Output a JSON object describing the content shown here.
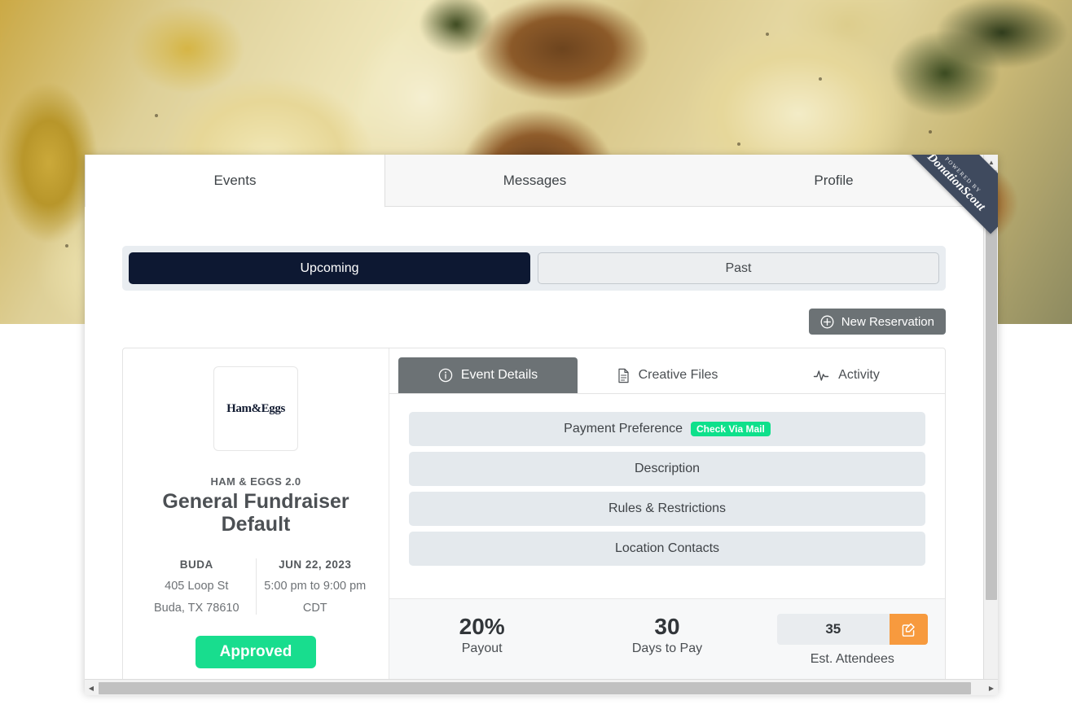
{
  "background": {
    "description": "food-photo-walnuts-potatoes"
  },
  "ribbon": {
    "powered_by": "POWERED BY",
    "brand": "DonationScout"
  },
  "top_tabs": [
    {
      "label": "Events",
      "active": true
    },
    {
      "label": "Messages",
      "active": false
    },
    {
      "label": "Profile",
      "active": false
    }
  ],
  "segment": {
    "upcoming_label": "Upcoming",
    "past_label": "Past",
    "active": "Upcoming"
  },
  "toolbar": {
    "new_reservation_label": "New Reservation"
  },
  "event": {
    "logo_text": "Ham&Eggs",
    "org_name": "HAM & EGGS 2.0",
    "title": "General Fundraiser Default",
    "location": {
      "city": "BUDA",
      "street": "405 Loop St",
      "region": "Buda, TX 78610"
    },
    "schedule": {
      "date": "JUN 22, 2023",
      "time": "5:00 pm to 9:00 pm",
      "timezone": "CDT"
    },
    "status": "Approved"
  },
  "detail_tabs": [
    {
      "label": "Event Details",
      "icon": "info-circle-icon",
      "active": true
    },
    {
      "label": "Creative Files",
      "icon": "document-icon",
      "active": false
    },
    {
      "label": "Activity",
      "icon": "pulse-icon",
      "active": false
    }
  ],
  "accordion": [
    {
      "label": "Payment Preference",
      "pill": "Check Via Mail"
    },
    {
      "label": "Description",
      "pill": ""
    },
    {
      "label": "Rules & Restrictions",
      "pill": ""
    },
    {
      "label": "Location Contacts",
      "pill": ""
    }
  ],
  "stats": [
    {
      "value": "20%",
      "label": "Payout"
    },
    {
      "value": "30",
      "label": "Days to Pay"
    }
  ],
  "attendees": {
    "value": "35",
    "label": "Est. Attendees",
    "edit_icon": "edit-pencil-square-icon"
  },
  "colors": {
    "segment_active": "#0d1832",
    "status_green": "#18dd8e",
    "pill_green": "#0ee08b",
    "edit_orange": "#f79a3e",
    "tab_active_gray": "#6c7275",
    "ribbon_navy": "#3f4a5e"
  },
  "scrollbars": {
    "vertical_arrow_up": "▲",
    "vertical_arrow_down": "▼",
    "horizontal_arrow_left": "◀",
    "horizontal_arrow_right": "▶"
  }
}
